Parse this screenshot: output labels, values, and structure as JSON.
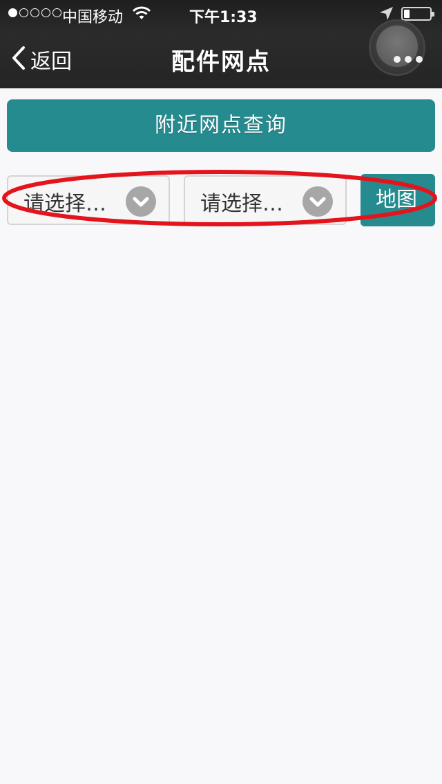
{
  "status_bar": {
    "carrier": "中国移动",
    "time": "下午1:33",
    "signal_filled": 1,
    "signal_total": 5,
    "battery_level": 0.15
  },
  "nav": {
    "back_label": "返回",
    "title": "配件网点"
  },
  "main": {
    "search_button_label": "附近网点查询",
    "select_1_value": "请选择…",
    "select_2_value": "请选择…",
    "map_button_label": "地图"
  },
  "colors": {
    "accent": "#268b8f",
    "header_bg": "#252525",
    "annotation": "#e4141c"
  },
  "icons": [
    "wifi-icon",
    "location-arrow-icon",
    "battery-icon",
    "back-chevron-icon",
    "more-icon",
    "chevron-down-icon"
  ]
}
